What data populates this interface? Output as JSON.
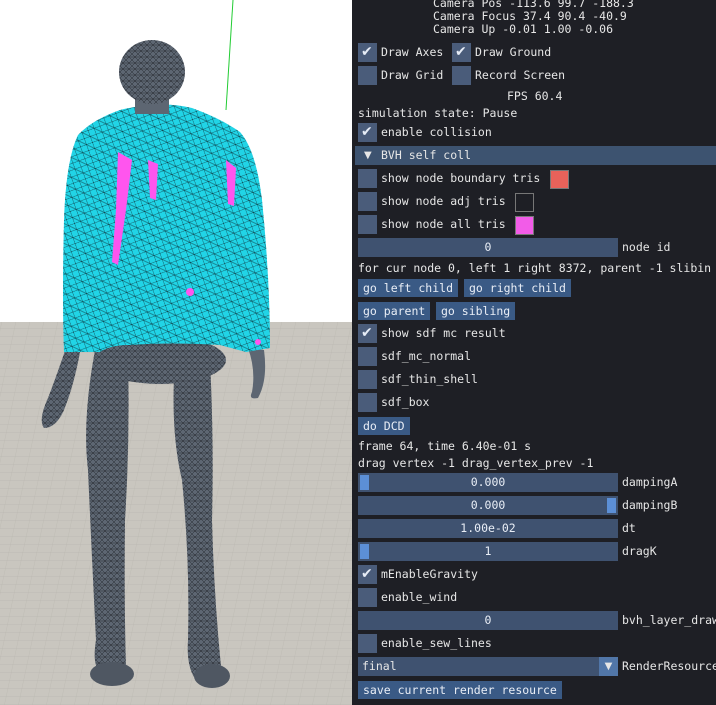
{
  "viewport": {
    "colors": {
      "background": "#ffffff",
      "ground": "#c8c5be",
      "shirt": "#21d4e6",
      "highlight": "#ff55ee",
      "body": "#5d6672",
      "wire": "#111111",
      "axis_green": "#22cc33"
    }
  },
  "camera": {
    "pos": "Camera Pos -113.6 99.7 -188.3",
    "focus": "Camera Focus 37.4 90.4 -40.9",
    "up": "Camera Up -0.01 1.00 -0.06"
  },
  "toggles": {
    "draw_axes": {
      "label": "Draw Axes",
      "checked": true
    },
    "draw_ground": {
      "label": "Draw Ground",
      "checked": true
    },
    "draw_grid": {
      "label": "Draw Grid",
      "checked": false
    },
    "record_screen": {
      "label": "Record Screen",
      "checked": false
    }
  },
  "fps": "FPS 60.4",
  "simulation_state": "simulation state: Pause",
  "enable_collision": {
    "label": "enable collision",
    "checked": true
  },
  "bvh_section": {
    "title": "BVH self coll",
    "show_node_boundary": {
      "label": "show node boundary tris",
      "checked": false,
      "color": "#e8625a"
    },
    "show_node_adj": {
      "label": "show node adj tris",
      "checked": false,
      "color": "#1e1f25"
    },
    "show_node_all": {
      "label": "show node all tris",
      "checked": false,
      "color": "#f25ce8"
    },
    "node_id": {
      "value": "0",
      "label": "node id"
    },
    "node_info": "for cur node 0, left 1 right 8372, parent -1 slibin",
    "go_left_child": "go left child",
    "go_right_child": "go right child",
    "go_parent": "go parent",
    "go_sibling": "go sibling"
  },
  "sdf": {
    "show_sdf_mc_result": {
      "label": "show sdf mc result",
      "checked": true
    },
    "sdf_mc_normal": {
      "label": "sdf_mc_normal",
      "checked": false
    },
    "sdf_thin_shell": {
      "label": "sdf_thin_shell",
      "checked": false
    },
    "sdf_box": {
      "label": "sdf_box",
      "checked": false
    }
  },
  "do_dcd": "do DCD",
  "frame_info": "frame 64, time 6.40e-01 s",
  "drag_info": "drag vertex -1 drag_vertex_prev -1",
  "params": {
    "damping_a": {
      "value": "0.000",
      "label": "dampingA",
      "fraction": 0.0
    },
    "damping_b": {
      "value": "0.000",
      "label": "dampingB",
      "fraction": 1.0
    },
    "dt": {
      "value": "1.00e-02",
      "label": "dt"
    },
    "drag_k": {
      "value": "1",
      "label": "dragK",
      "fraction": 0.0
    }
  },
  "gravity": {
    "label": "mEnableGravity",
    "checked": true
  },
  "wind": {
    "label": "enable_wind",
    "checked": false
  },
  "bvh_layer": {
    "value": "0",
    "label": "bvh_layer_draw"
  },
  "sew_lines": {
    "label": "enable_sew_lines",
    "checked": false
  },
  "render_resource": {
    "value": "final",
    "label": "RenderResource"
  },
  "save_render": "save current render resource",
  "panel_colors": {
    "panel_bg": "#1e1f25",
    "widget": "#3f5270",
    "button": "#3a5a85",
    "accent": "#5c8fd6"
  }
}
